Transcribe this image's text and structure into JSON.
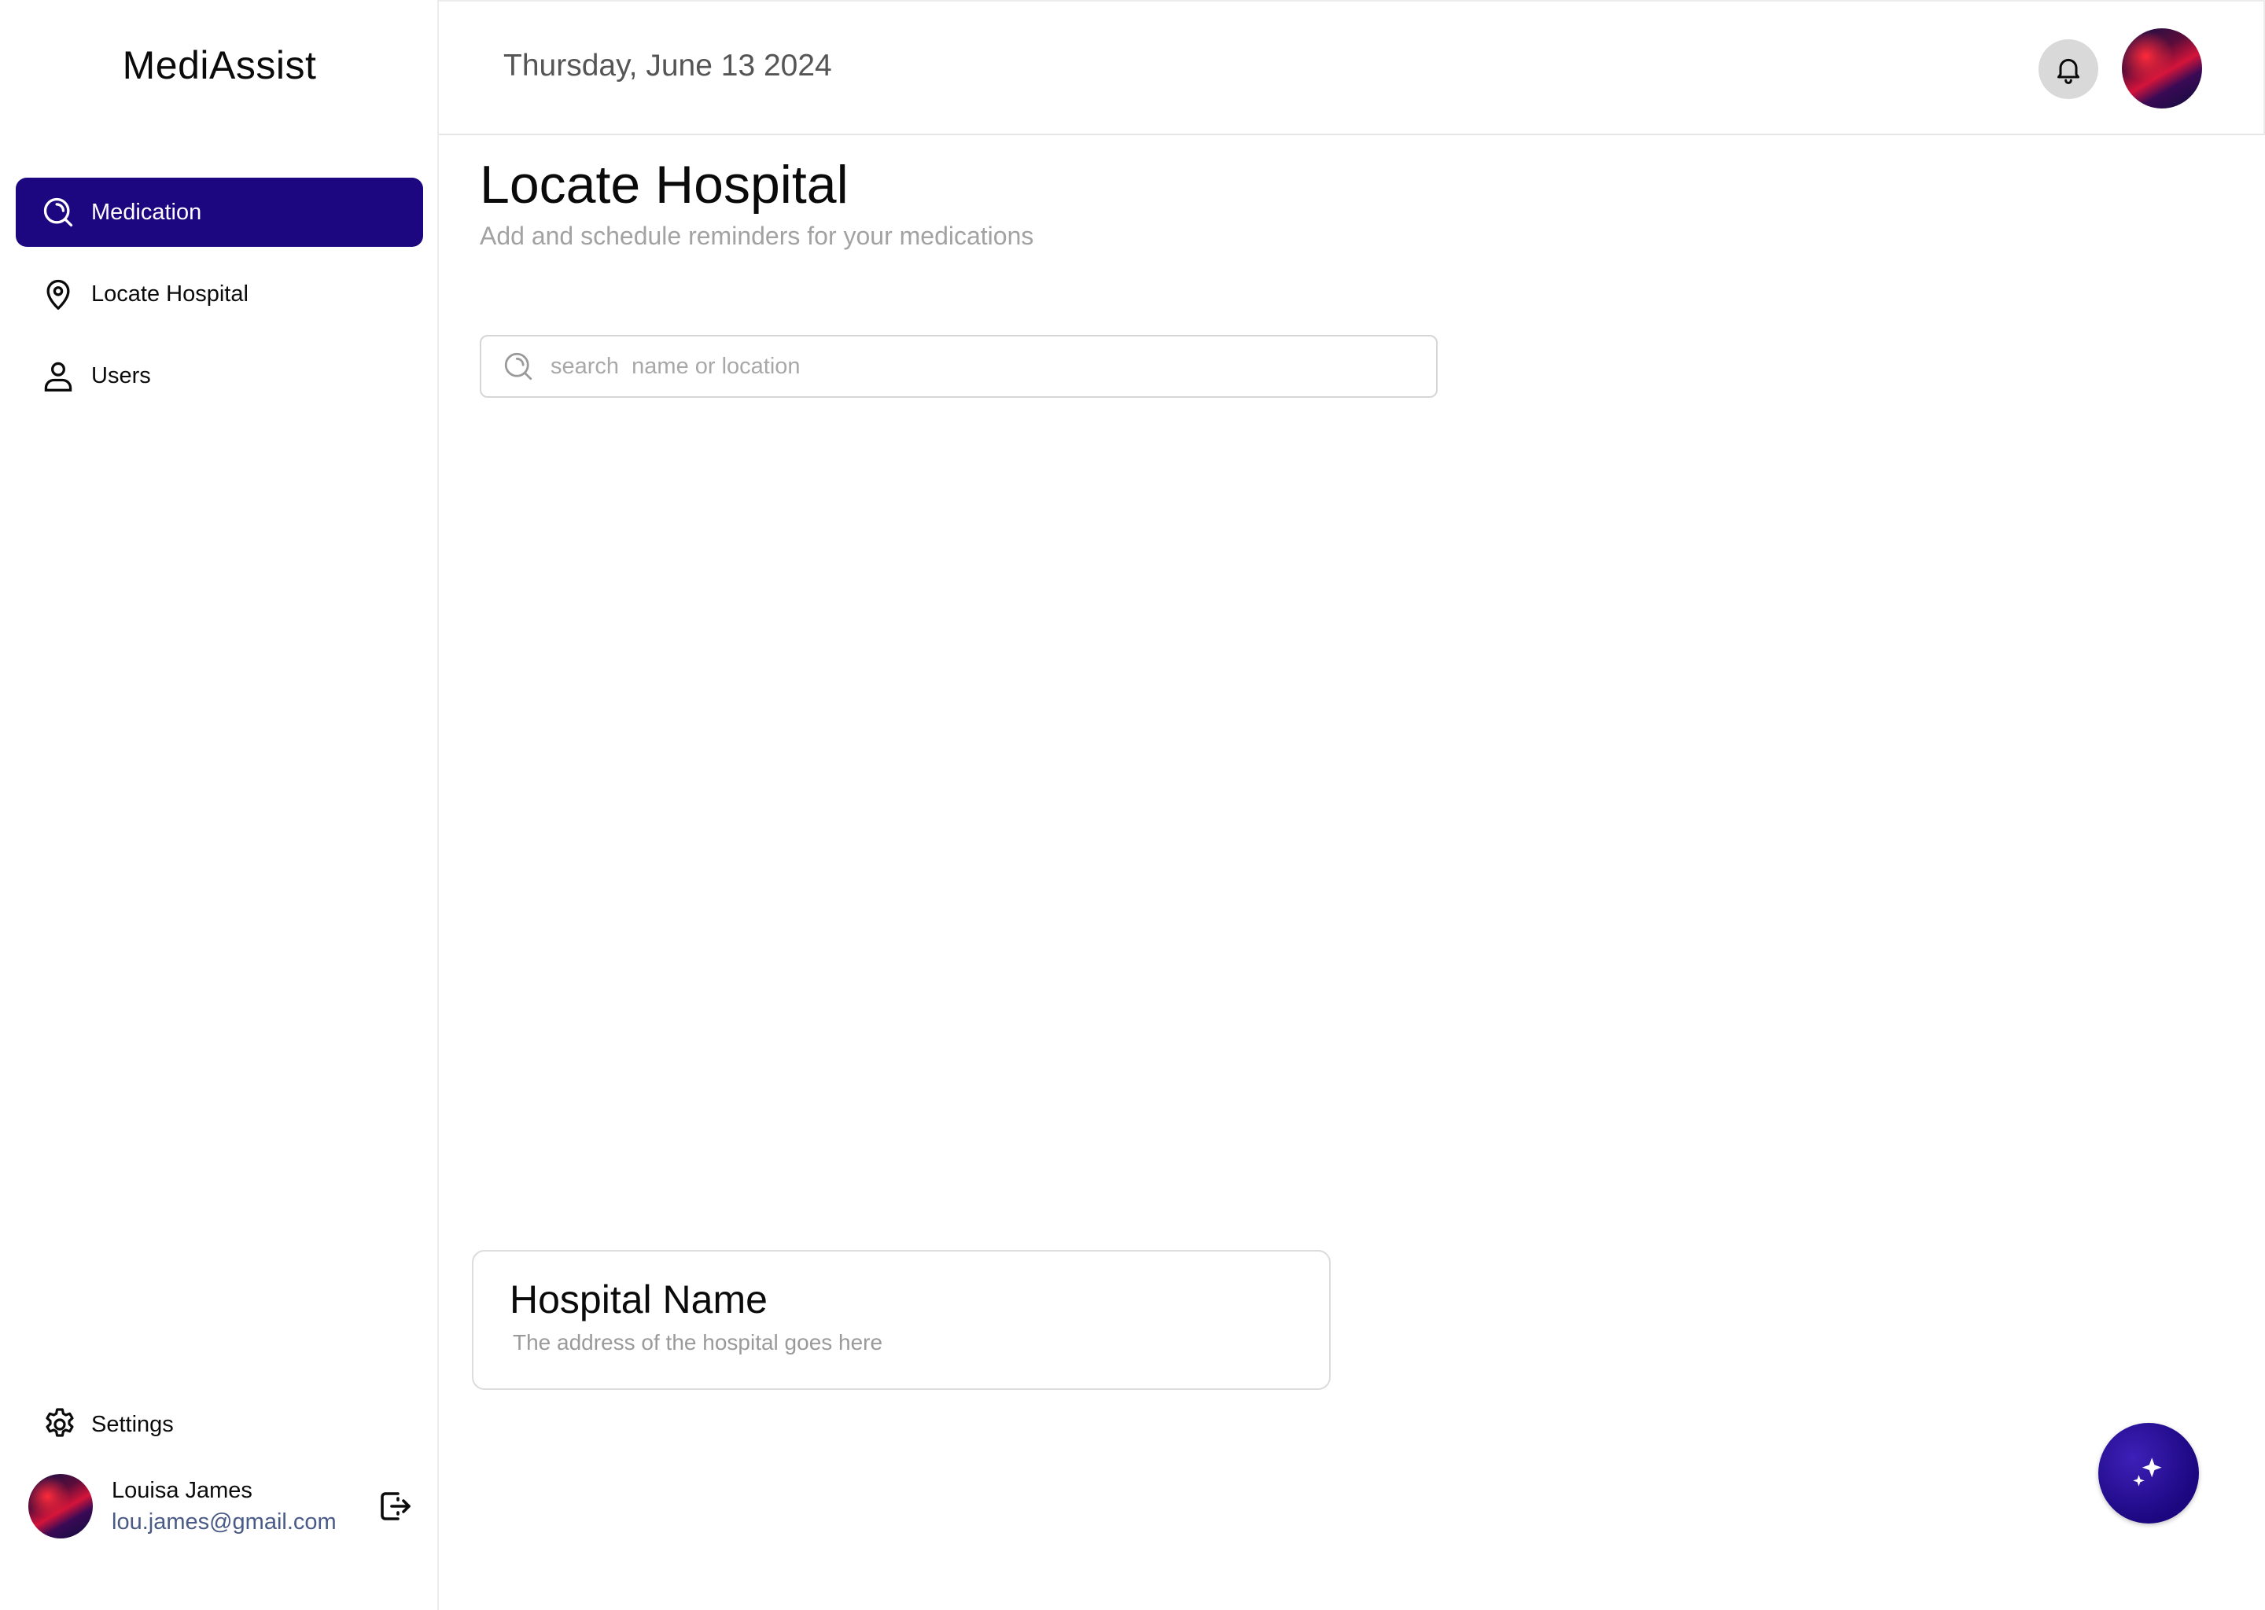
{
  "app": {
    "brand": "MediAssist"
  },
  "sidebar": {
    "items": [
      {
        "label": "Medication",
        "icon": "search-icon",
        "active": true
      },
      {
        "label": "Locate Hospital",
        "icon": "location-pin-icon",
        "active": false
      },
      {
        "label": "Users",
        "icon": "user-icon",
        "active": false
      }
    ],
    "settings_label": "Settings",
    "user": {
      "name": "Louisa James",
      "email": "lou.james@gmail.com"
    }
  },
  "header": {
    "date": "Thursday, June 13 2024"
  },
  "main": {
    "title": "Locate Hospital",
    "subtitle": "Add and schedule reminders for your  medications",
    "search": {
      "placeholder": "search  name or location"
    },
    "hospital_card": {
      "name": "Hospital Name",
      "address": "The address of the hospital goes here"
    }
  },
  "colors": {
    "accent": "#1c0780",
    "subtitle": "#a2a2a2",
    "email": "#4a5a86"
  }
}
